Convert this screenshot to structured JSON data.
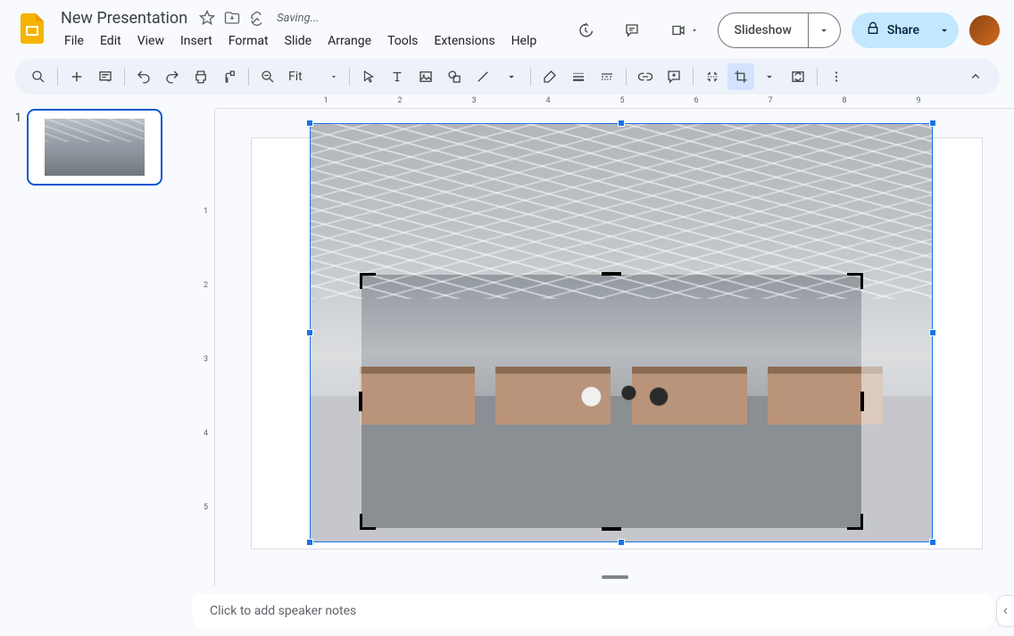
{
  "header": {
    "doc_title": "New Presentation",
    "save_status": "Saving...",
    "menus": [
      "File",
      "Edit",
      "View",
      "Insert",
      "Format",
      "Slide",
      "Arrange",
      "Tools",
      "Extensions",
      "Help"
    ],
    "slideshow_label": "Slideshow",
    "share_label": "Share"
  },
  "toolbar": {
    "zoom_label": "Fit"
  },
  "filmstrip": {
    "slides": [
      {
        "number": "1"
      }
    ]
  },
  "ruler": {
    "h": [
      "1",
      "2",
      "3",
      "4",
      "5",
      "6",
      "7",
      "8",
      "9"
    ],
    "v": [
      "1",
      "2",
      "3",
      "4",
      "5"
    ]
  },
  "notes": {
    "placeholder": "Click to add speaker notes"
  }
}
